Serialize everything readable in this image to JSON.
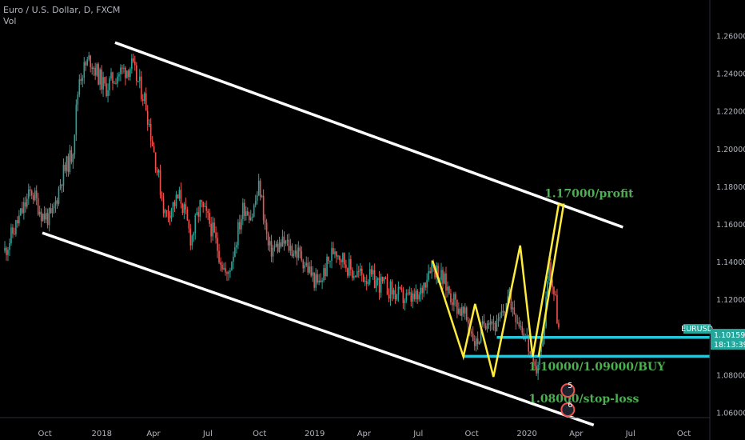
{
  "header": {
    "symbol_line": "Euro / U.S. Dollar, D, FXCM",
    "indicator": "Vol"
  },
  "chart_data": {
    "type": "candlestick",
    "symbol": "EURUSD",
    "x_ticks": [
      "Oct",
      "2018",
      "Apr",
      "Jul",
      "Oct",
      "2019",
      "Apr",
      "Jul",
      "Oct",
      "2020",
      "Apr",
      "Jul",
      "Oct"
    ],
    "y_ticks": [
      "1.26000",
      "1.24000",
      "1.22000",
      "1.20000",
      "1.18000",
      "1.16000",
      "1.14000",
      "1.12000",
      "1.10000",
      "1.08000",
      "1.06000"
    ],
    "y_range": [
      1.052,
      1.275
    ],
    "price_path": [
      [
        0.0,
        1.146
      ],
      [
        3.2,
        1.178
      ],
      [
        4.5,
        1.165
      ],
      [
        5.6,
        1.163
      ],
      [
        6.8,
        1.185
      ],
      [
        8.1,
        1.198
      ],
      [
        8.9,
        1.238
      ],
      [
        10.2,
        1.248
      ],
      [
        12.0,
        1.232
      ],
      [
        13.5,
        1.24
      ],
      [
        15.2,
        1.244
      ],
      [
        16.8,
        1.226
      ],
      [
        17.8,
        1.2
      ],
      [
        19.2,
        1.165
      ],
      [
        21.0,
        1.175
      ],
      [
        22.3,
        1.152
      ],
      [
        23.4,
        1.17
      ],
      [
        24.6,
        1.16
      ],
      [
        26.6,
        1.131
      ],
      [
        28.6,
        1.17
      ],
      [
        29.6,
        1.165
      ],
      [
        30.5,
        1.181
      ],
      [
        31.6,
        1.146
      ],
      [
        33.5,
        1.15
      ],
      [
        35.5,
        1.143
      ],
      [
        37.5,
        1.127
      ],
      [
        39.5,
        1.148
      ],
      [
        41.5,
        1.135
      ],
      [
        43.5,
        1.132
      ],
      [
        45.5,
        1.127
      ],
      [
        47.5,
        1.121
      ],
      [
        49.5,
        1.12
      ],
      [
        51.0,
        1.14
      ],
      [
        52.5,
        1.13
      ],
      [
        54.0,
        1.118
      ],
      [
        55.5,
        1.108
      ],
      [
        56.4,
        1.096
      ],
      [
        57.8,
        1.112
      ],
      [
        59.0,
        1.105
      ],
      [
        60.3,
        1.122
      ],
      [
        61.5,
        1.11
      ],
      [
        62.5,
        1.099
      ],
      [
        63.4,
        1.08
      ],
      [
        64.4,
        1.097
      ],
      [
        65.1,
        1.14
      ],
      [
        65.9,
        1.12
      ],
      [
        66.4,
        1.101
      ]
    ],
    "last_price": "1.10159",
    "countdown": "18:13:39",
    "channel": {
      "upper": [
        [
          13.2,
          1.2565
        ],
        [
          74.0,
          1.1585
        ]
      ],
      "lower": [
        [
          4.5,
          1.1555
        ],
        [
          70.5,
          1.0535
        ]
      ]
    },
    "pattern_line": {
      "color": "#ffeb3b",
      "points": [
        [
          51.2,
          1.1408
        ],
        [
          54.9,
          1.0898
        ],
        [
          56.3,
          1.1178
        ],
        [
          58.5,
          1.0791
        ],
        [
          61.7,
          1.1488
        ],
        [
          63.2,
          1.0898
        ],
        [
          66.3,
          1.1705
        ],
        [
          66.9,
          1.1705
        ],
        [
          63.9,
          1.0898
        ]
      ]
    },
    "horizontal_levels": [
      {
        "from": 58.9,
        "value": 1.1,
        "color": "#26c6da"
      },
      {
        "from": 54.9,
        "value": 1.09,
        "color": "#26c6da"
      }
    ],
    "annotations": [
      {
        "text": "1.17000/profit",
        "x": 64.6,
        "y": 1.1745
      },
      {
        "text": "1.10000/1.09000/BUY",
        "x": 62.7,
        "y": 1.0825
      },
      {
        "text": "1.08000/stop-loss",
        "x": 62.7,
        "y": 1.0655
      }
    ],
    "event_badges": [
      "5",
      "6"
    ],
    "colors": {
      "up": "#26a69a",
      "down": "#ef5350",
      "channel": "#ffffff",
      "label": "#4caf50",
      "price_tag": "#26a69a"
    }
  }
}
